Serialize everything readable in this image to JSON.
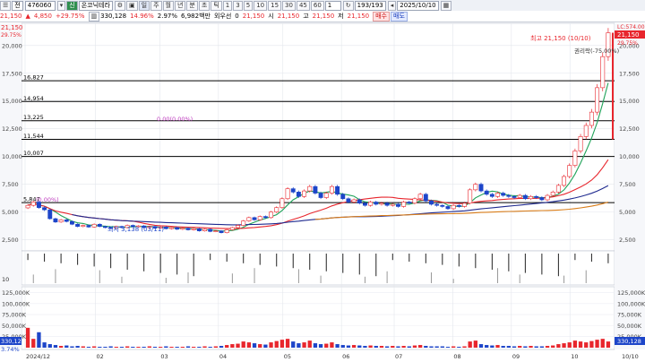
{
  "toolbar": {
    "cmd_icon": "command-icon",
    "ticker_prefix": "전",
    "code": "476060",
    "market_badge": "신",
    "name": "온코닉테라",
    "periods": [
      "일",
      "주",
      "월",
      "년",
      "분",
      "초",
      "틱"
    ],
    "selected_period": "일",
    "intervals": [
      "1",
      "3",
      "5",
      "10",
      "15",
      "30",
      "45",
      "60"
    ],
    "count_value": "1",
    "page_counter": "193/193",
    "date_value": "2025/10/10"
  },
  "quote": {
    "price": "21,150",
    "change": "4,850",
    "change_pct": "+29.75%",
    "volume": "330,128",
    "turnover_pct": "14.96%",
    "ratio_pct": "2.97%",
    "value": "6,982백만",
    "label_foreign": "외우선",
    "foreign_val": "0",
    "price2": "21,150",
    "label_open": "시",
    "open": "21,150",
    "label_high": "고",
    "high": "21,150",
    "label_low": "저",
    "low": "21,150",
    "buy_label": "매수",
    "sell_label": "매도"
  },
  "colors": {
    "up": "#e8262d",
    "down": "#1d45c9",
    "ma5": "#21a35a",
    "ma20": "#e8262d",
    "ma60": "#1f2a8f",
    "ma120": "#d97d1a"
  },
  "chart_data": {
    "type": "candlestick",
    "price_axis_labels": [
      "20,000",
      "17,500",
      "15,000",
      "12,500",
      "10,000",
      "7,500",
      "5,000",
      "2,500"
    ],
    "right_header": [
      "LC:574.00",
      "21,150",
      "29.75%"
    ],
    "left_header": [
      "21,150",
      "29.75%"
    ],
    "date_labels": [
      "2024/12",
      "02",
      "03",
      "04",
      "05",
      "06",
      "07",
      "08",
      "09",
      "10",
      "10/10"
    ],
    "fib_levels": [
      {
        "label": "16,827",
        "value": 16827
      },
      {
        "label": "14,954",
        "value": 14954
      },
      {
        "label": "13,225",
        "value": 13225
      },
      {
        "label": "11,544",
        "value": 11544
      },
      {
        "label": "10,007",
        "value": 10007
      },
      {
        "label": "5,847",
        "value": 5847
      }
    ],
    "fib_pct_label_1": "0.00(0.00%)",
    "fib_pct_label_2": "(0.00%)",
    "annotation_high": "최고 21,150 (10/10)",
    "annotation_rights": "권리락(-75.00%)",
    "annotation_low": "최저 3,138 (03/11)",
    "volume_axis_labels": [
      "125,000K",
      "100,000K",
      "75,000K",
      "50,000K",
      "25,000K"
    ],
    "volume_last": "330,128",
    "volume_pct": "3.74%",
    "indicator_axis_label": "10",
    "closes": [
      5600,
      5900,
      5400,
      5200,
      4400,
      4100,
      4300,
      4150,
      3900,
      3700,
      3800,
      3650,
      3900,
      3700,
      3600,
      3550,
      3700,
      3600,
      3800,
      3700,
      3750,
      3600,
      3700,
      3550,
      3650,
      3500,
      3600,
      3450,
      3550,
      3400,
      3500,
      3300,
      3450,
      3250,
      3300,
      3138,
      3400,
      3600,
      3800,
      4200,
      4500,
      4300,
      4600,
      4500,
      5000,
      5400,
      6200,
      7100,
      6800,
      6400,
      6900,
      7300,
      6700,
      6300,
      6700,
      7300,
      6600,
      6200,
      5900,
      6100,
      5800,
      5600,
      5900,
      5700,
      5800,
      5600,
      5700,
      5500,
      5900,
      5800,
      6200,
      6600,
      6000,
      5700,
      5600,
      5500,
      5300,
      5600,
      5500,
      5800,
      7000,
      7500,
      6900,
      6600,
      6400,
      6700,
      6500,
      6400,
      6300,
      6500,
      6200,
      6400,
      6300,
      6100,
      6500,
      6800,
      7400,
      8200,
      9200,
      10500,
      11800,
      12800,
      14000,
      16200,
      19000,
      21150
    ],
    "volumes": [
      45,
      20,
      35,
      12,
      8,
      6,
      4,
      5,
      3,
      4,
      3,
      2,
      3,
      2,
      2,
      3,
      2,
      2,
      3,
      2,
      2,
      2,
      3,
      2,
      2,
      3,
      2,
      2,
      2,
      3,
      2,
      2,
      3,
      2,
      3,
      4,
      6,
      8,
      9,
      14,
      12,
      10,
      8,
      7,
      12,
      15,
      18,
      20,
      14,
      10,
      12,
      16,
      10,
      8,
      9,
      12,
      8,
      6,
      5,
      6,
      5,
      4,
      5,
      4,
      4,
      3,
      4,
      3,
      4,
      3,
      5,
      6,
      4,
      3,
      3,
      3,
      2,
      3,
      2,
      3,
      14,
      16,
      8,
      6,
      5,
      6,
      4,
      4,
      3,
      4,
      3,
      4,
      3,
      3,
      4,
      5,
      8,
      10,
      12,
      16,
      14,
      12,
      15,
      18,
      20,
      14
    ]
  }
}
